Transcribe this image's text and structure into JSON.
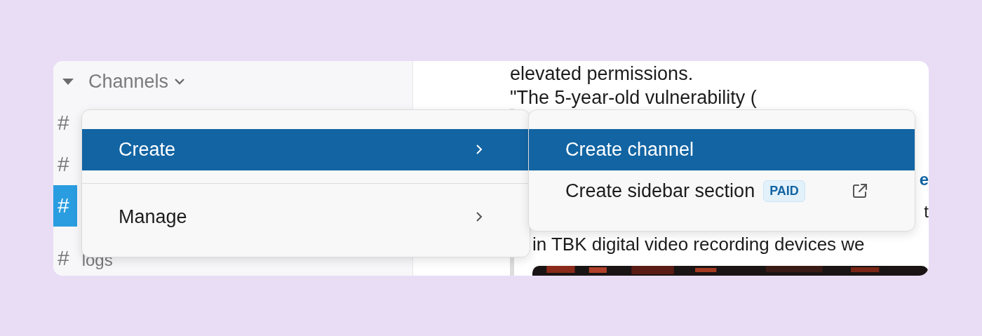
{
  "sidebar": {
    "section": {
      "label": "Channels",
      "expanded": true
    },
    "channels": [
      {
        "hash": "#",
        "selected": false
      },
      {
        "hash": "#",
        "selected": false
      },
      {
        "hash": "#",
        "selected": true
      },
      {
        "hash": "#",
        "name": "logs",
        "selected": false
      }
    ]
  },
  "content": {
    "lines": [
      "elevated permissions.",
      "\"The 5-year-old vulnerability ("
    ],
    "quote": {
      "fragments": [
        {
          "text": "e",
          "kind": "link"
        },
        {
          "text": "t",
          "kind": "plain"
        }
      ],
      "line": "in TBK digital video recording devices we"
    }
  },
  "menu": {
    "items": [
      {
        "label": "Create",
        "selected": true
      },
      {
        "label": "Manage",
        "selected": false
      }
    ]
  },
  "submenu": {
    "items": [
      {
        "label": "Create channel",
        "selected": true,
        "external": false
      },
      {
        "label": "Create sidebar section",
        "badge": "PAID",
        "selected": false,
        "external": true
      }
    ]
  }
}
